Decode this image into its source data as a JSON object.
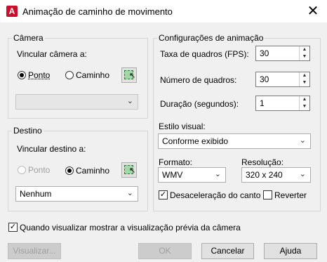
{
  "window": {
    "title": "Animação de caminho de movimento",
    "app_icon_letter": "A"
  },
  "camera_group": {
    "title": "Câmera",
    "link_label": "Vincular câmera a:",
    "radio_point": "Ponto",
    "radio_path": "Caminho",
    "selected": "Ponto",
    "combo_value": ""
  },
  "destination_group": {
    "title": "Destino",
    "link_label": "Vincular destino a:",
    "radio_point": "Ponto",
    "radio_path": "Caminho",
    "selected": "Caminho",
    "combo_value": "Nenhum"
  },
  "animation_settings": {
    "title": "Configurações de animação",
    "frame_rate_label": "Taxa de quadros (FPS):",
    "frame_rate_value": "30",
    "frame_count_label": "Número de quadros:",
    "frame_count_value": "30",
    "duration_label": "Duração (segundos):",
    "duration_value": "1",
    "visual_style_label": "Estilo visual:",
    "visual_style_value": "Conforme exibido",
    "format_label": "Formato:",
    "format_value": "WMV",
    "resolution_label": "Resolução:",
    "resolution_value": "320 x 240",
    "decel_label": "Desaceleração do canto",
    "decel_checked": true,
    "reverse_label": "Reverter",
    "reverse_checked": false
  },
  "preview_checkbox": {
    "label": "Quando visualizar mostrar a visualização prévia da câmera",
    "checked": true
  },
  "buttons": {
    "preview": "Visualizar...",
    "ok": "OK",
    "cancel": "Cancelar",
    "help": "Ajuda"
  },
  "icons": {
    "check": "✓",
    "close": "✕",
    "dropdown": "⌄",
    "spin_up": "▲",
    "spin_down": "▼",
    "cursor": "↖"
  }
}
